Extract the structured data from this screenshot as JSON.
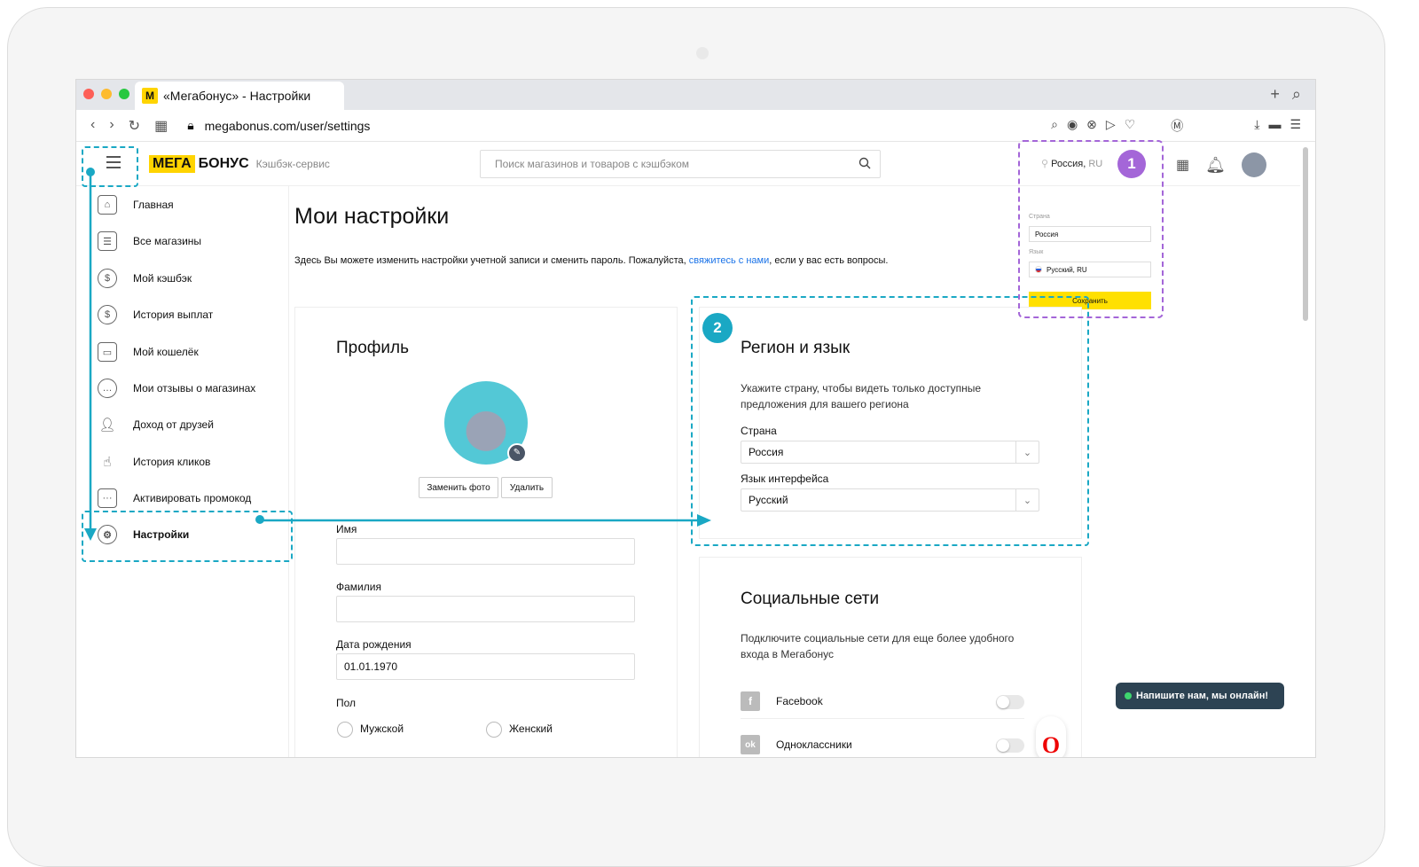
{
  "browser": {
    "tab_title": "«Мегабонус» - Настройки",
    "tab_logo": "М",
    "url": "megabonus.com/user/settings",
    "new_tab": "+",
    "search_glyph": "⌕"
  },
  "header": {
    "logo_mega": "МЕГА",
    "logo_bonus": "БОНУС",
    "logo_sub": "Кэшбэк-сервис",
    "search_placeholder": "Поиск магазинов и товаров с кэшбэком",
    "region_label": "Россия,",
    "region_code": "RU"
  },
  "sidebar": {
    "items": [
      {
        "label": "Главная",
        "icon": "home-icon"
      },
      {
        "label": "Все магазины",
        "icon": "list-icon"
      },
      {
        "label": "Мой кэшбэк",
        "icon": "coin-icon"
      },
      {
        "label": "История выплат",
        "icon": "dollar-history-icon"
      },
      {
        "label": "Мой кошелёк",
        "icon": "wallet-icon"
      },
      {
        "label": "Мои отзывы о магазинах",
        "icon": "comment-icon"
      },
      {
        "label": "Доход от друзей",
        "icon": "friends-income-icon"
      },
      {
        "label": "История кликов",
        "icon": "click-icon"
      },
      {
        "label": "Активировать промокод",
        "icon": "promo-icon"
      },
      {
        "label": "Настройки",
        "icon": "gear-icon"
      }
    ]
  },
  "main": {
    "title": "Мои настройки",
    "desc_before": "Здесь Вы можете изменить настройки учетной записи и сменить пароль. Пожалуйста, ",
    "desc_link": "свяжитесь с нами",
    "desc_after": ", если у вас есть вопросы."
  },
  "profile": {
    "title": "Профиль",
    "change_photo": "Заменить фото",
    "delete_photo": "Удалить",
    "name_label": "Имя",
    "name_value": "",
    "surname_label": "Фамилия",
    "surname_value": "",
    "birth_label": "Дата рождения",
    "birth_value": "01.01.1970",
    "gender_label": "Пол",
    "gender_male": "Мужской",
    "gender_female": "Женский"
  },
  "region": {
    "title": "Регион и язык",
    "subtitle": "Укажите страну, чтобы видеть только доступные предложения для вашего региона",
    "country_label": "Страна",
    "country_value": "Россия",
    "lang_label": "Язык интерфейса",
    "lang_value": "Русский"
  },
  "social": {
    "title": "Социальные сети",
    "subtitle": "Подключите социальные сети для еще более удобного входа в Мегабонус",
    "items": [
      {
        "label": "Facebook",
        "icon": "facebook-icon",
        "glyph": "f",
        "connected": false
      },
      {
        "label": "Одноклассники",
        "icon": "odnoklassniki-icon",
        "glyph": "ok",
        "connected": false
      }
    ]
  },
  "popup": {
    "country_label": "Страна",
    "country_value": "Россия",
    "lang_label": "Язык",
    "lang_value": "Русский, RU",
    "save": "Сохранить"
  },
  "chat": {
    "label": "Напишите нам, мы онлайн!"
  },
  "opera_glyph": "O",
  "badges": {
    "one": "1",
    "two": "2"
  },
  "colors": {
    "brand_yellow": "#ffd400",
    "annotation_teal": "#1aa8c4",
    "annotation_purple": "#a466d8",
    "link_blue": "#1a73e8",
    "chat_bg": "#2d4353"
  }
}
